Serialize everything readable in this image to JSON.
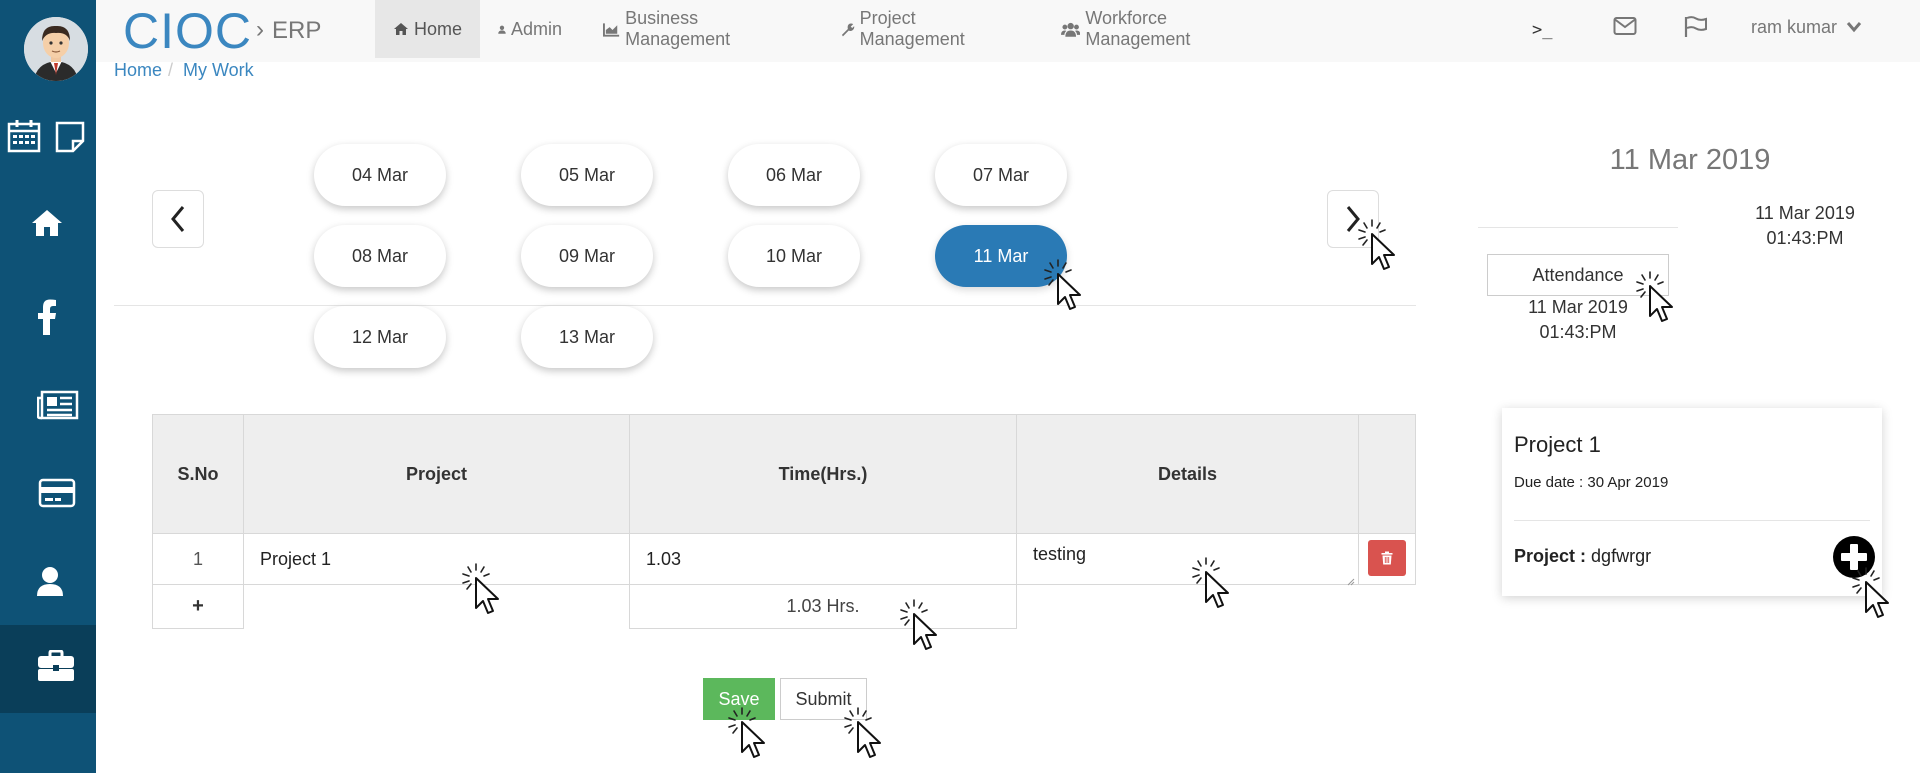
{
  "brand": {
    "name": "CIOC",
    "sub": "ERP"
  },
  "nav": {
    "items": [
      {
        "label": "Home",
        "icon": "home-icon"
      },
      {
        "label": "Admin",
        "icon": "user-icon"
      },
      {
        "label": "Business Management",
        "icon": "chart-icon"
      },
      {
        "label": "Project Management",
        "icon": "wrench-icon"
      },
      {
        "label": "Workforce Management",
        "icon": "group-icon"
      }
    ],
    "terminal": ">_",
    "user": "ram kumar"
  },
  "breadcrumb": {
    "home": "Home",
    "sep": "/",
    "current": "My Work"
  },
  "dates": [
    "04 Mar",
    "05 Mar",
    "06 Mar",
    "07 Mar",
    "08 Mar",
    "09 Mar",
    "10 Mar",
    "11 Mar",
    "12 Mar",
    "13 Mar"
  ],
  "selected_date": "11 Mar",
  "table": {
    "headers": {
      "sno": "S.No",
      "project": "Project",
      "time": "Time(Hrs.)",
      "details": "Details"
    },
    "rows": [
      {
        "sno": "1",
        "project": "Project 1",
        "time": "1.03",
        "details": "testing"
      }
    ],
    "add_symbol": "+",
    "total": "1.03 Hrs."
  },
  "buttons": {
    "save": "Save",
    "submit": "Submit"
  },
  "right": {
    "date_title": "11 Mar 2019",
    "last_date": "11 Mar 2019",
    "last_time": "01:43:PM",
    "attendance_label": "Attendance",
    "att_date": "11 Mar 2019",
    "att_time": "01:43:PM"
  },
  "card": {
    "title": "Project 1",
    "due_label": "Due date : 30 Apr 2019",
    "project_label": "Project :",
    "project_value": "dgfwrgr"
  },
  "colors": {
    "sidebar": "#0e5276",
    "accent": "#2a7ab5",
    "save": "#5cb85c",
    "delete": "#d9534f"
  }
}
